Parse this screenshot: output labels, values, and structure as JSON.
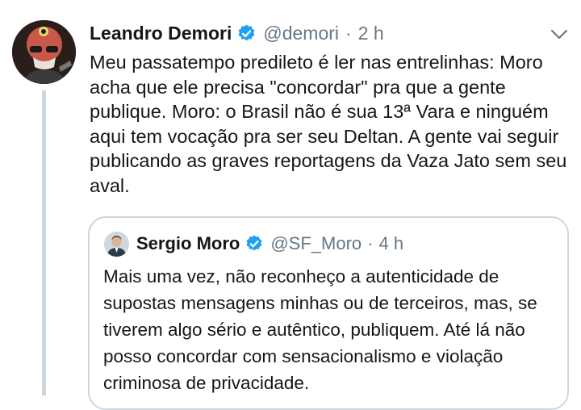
{
  "tweet": {
    "author_name": "Leandro Demori",
    "author_handle": "@demori",
    "separator": "·",
    "time": "2 h",
    "text": "Meu passatempo predileto é ler nas entrelinhas: Moro acha que ele precisa \"concordar\" pra que a gente publique. Moro: o Brasil não é sua 13ª Vara e ninguém aqui tem vocação pra ser seu Deltan. A gente vai seguir publicando as graves reportagens da Vaza Jato sem seu aval.",
    "verified_icon": "verified-badge-icon",
    "menu_icon": "chevron-down-icon"
  },
  "quoted_tweet": {
    "author_name": "Sergio Moro",
    "author_handle": "@SF_Moro",
    "separator": "·",
    "time": "4 h",
    "text": "Mais uma vez, não reconheço a autenticidade de supostas mensagens minhas ou de terceiros, mas, se tiverem algo sério e autêntico, publiquem. Até lá não posso concordar com sensacionalismo e violação criminosa de privacidade."
  },
  "colors": {
    "verified": "#1da1f2",
    "secondary_text": "#657786",
    "border": "#ccd6dd"
  }
}
